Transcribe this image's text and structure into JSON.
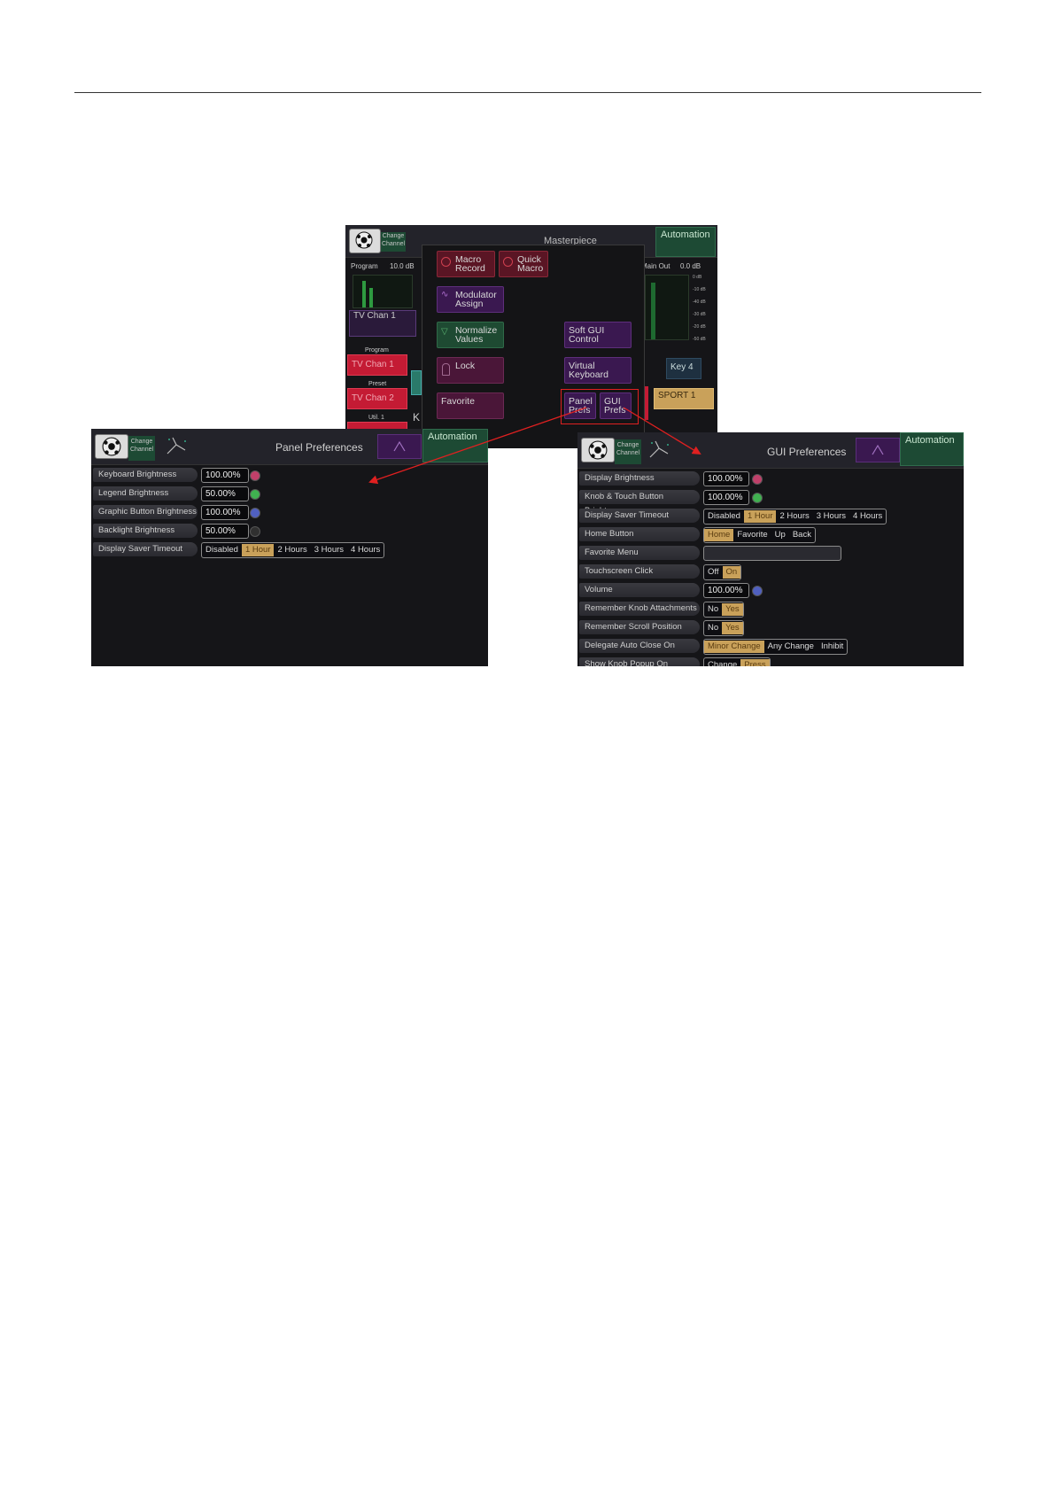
{
  "top_screen": {
    "header_title": "Masterpiece",
    "change_channel": "Change Channel",
    "automation": "Automation",
    "program_label": "Program",
    "program_db": "10.0 dB",
    "main_out_label": "Main Out",
    "main_out_db": "0.0 dB",
    "channel_box": "TV  Chan 1",
    "bus_program": "Program",
    "bus_program_value": "TV  Chan 1",
    "bus_preset": "Preset",
    "bus_preset_value": "TV  Chan 2",
    "bus_util": "Util. 1",
    "key4": "Key 4",
    "sport1": "SPORT 1",
    "meter_scale": [
      "0 dB",
      "-10 dB",
      "-40 dB",
      "-30 dB",
      "-20 dB",
      "-50 dB"
    ],
    "menu_buttons": {
      "macro_record": "Macro Record",
      "quick_macro": "Quick Macro",
      "modulator_assign": "Modulator Assign",
      "normalize_values": "Normalize Values",
      "soft_gui_control": "Soft GUI Control",
      "lock": "Lock",
      "virtual_keyboard": "Virtual Keyboard",
      "favorite": "Favorite",
      "panel_prefs": "Panel Prefs",
      "gui_prefs": "GUI Prefs"
    },
    "partial_left_letter": "K"
  },
  "panel_prefs": {
    "title": "Panel Preferences",
    "change_channel": "Change Channel",
    "automation": "Automation",
    "rows": [
      {
        "label": "Keyboard Brightness",
        "value": "100.00%",
        "dot": "#c0406a"
      },
      {
        "label": "Legend Brightness",
        "value": "50.00%",
        "dot": "#40b050"
      },
      {
        "label": "Graphic Button Brightness",
        "value": "100.00%",
        "dot": "#5060c0"
      },
      {
        "label": "Backlight Brightness",
        "value": "50.00%",
        "dot": "#303030"
      }
    ],
    "saver_label": "Display Saver Timeout",
    "saver_options": [
      "Disabled",
      "1 Hour",
      "2 Hours",
      "3 Hours",
      "4 Hours"
    ]
  },
  "gui_prefs": {
    "title": "GUI Preferences",
    "change_channel": "Change Channel",
    "automation": "Automation",
    "display_brightness_label": "Display Brightness",
    "display_brightness_value": "100.00%",
    "knob_label": "Knob & Touch Button Brightness",
    "knob_value": "100.00%",
    "saver_label": "Display Saver Timeout",
    "saver_options": [
      "Disabled",
      "1 Hour",
      "2 Hours",
      "3 Hours",
      "4 Hours"
    ],
    "home_label": "Home Button",
    "home_options": [
      "Home",
      "Favorite",
      "Up",
      "Back"
    ],
    "favorite_menu_label": "Favorite Menu",
    "touch_label": "Touchscreen Click",
    "touch_options": [
      "Off",
      "On"
    ],
    "volume_label": "Volume",
    "volume_value": "100.00%",
    "knob_attach_label": "Remember Knob Attachments",
    "knob_attach_options": [
      "No",
      "Yes"
    ],
    "scroll_label": "Remember Scroll Position",
    "scroll_options": [
      "No",
      "Yes"
    ],
    "delegate_label": "Delegate Auto Close On",
    "delegate_options": [
      "Minor Change",
      "Any Change",
      "Inhibit"
    ],
    "popup_label": "Show Knob Popup On",
    "popup_options": [
      "Change",
      "Press"
    ]
  },
  "colors": {
    "arrow": "#e02020",
    "highlight_box": "#e02020",
    "selected_segment": "#c9a15a"
  }
}
